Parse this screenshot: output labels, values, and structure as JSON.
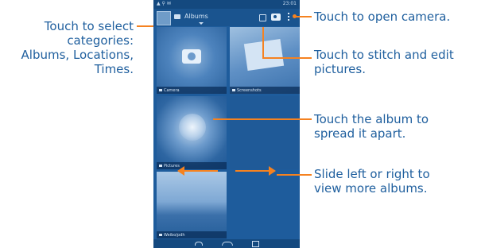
{
  "callouts": {
    "categories": {
      "line1": "Touch to select",
      "line2": "categories:",
      "line3": "Albums, Locations,",
      "line4": "Times."
    },
    "camera": {
      "line1": "Touch to open camera."
    },
    "stitch": {
      "line1": "Touch to stitch and edit",
      "line2": "pictures."
    },
    "album": {
      "line1": "Touch the album to",
      "line2": "spread it apart."
    },
    "slide": {
      "line1": "Slide left or right to",
      "line2": "view more albums."
    }
  },
  "screen": {
    "status_time": "23:01",
    "status_icons": "▲ ⚲ ✉",
    "actionbar_title": "Albums",
    "tiles": [
      {
        "label": "Camera"
      },
      {
        "label": "Screenshots"
      },
      {
        "label": "Pictures"
      },
      {
        "label": "Weibo/pdh"
      }
    ]
  },
  "icons": {
    "camera": "camera-icon",
    "stitch": "stitch-icon",
    "overflow": "overflow-menu-icon",
    "back": "back-icon",
    "home": "home-icon",
    "recent": "recent-apps-icon"
  },
  "colors": {
    "callout_text": "#1f5f9e",
    "leader": "#f58220",
    "screen_bg": "#1e5c9c"
  }
}
